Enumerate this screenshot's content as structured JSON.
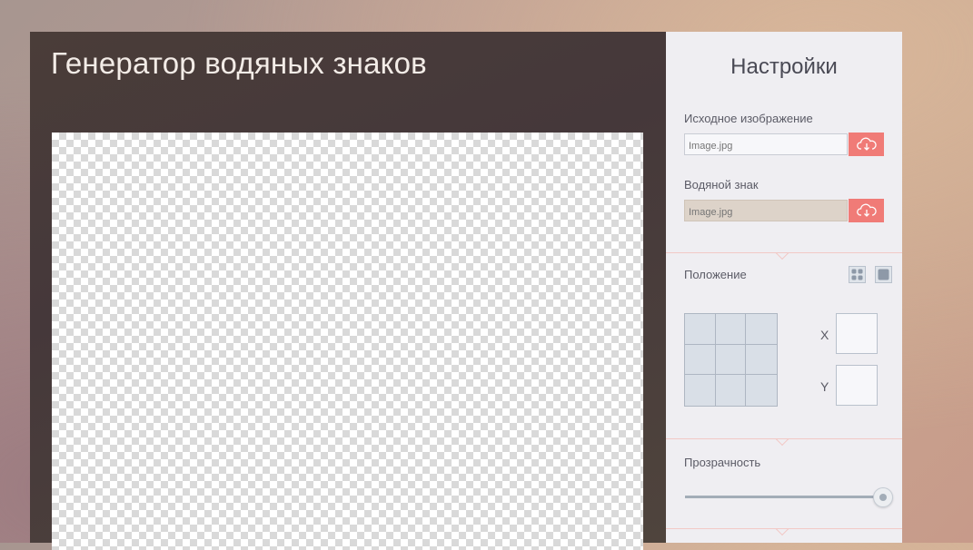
{
  "app": {
    "title": "Генератор водяных знаков"
  },
  "settings": {
    "title": "Настройки",
    "source_image": {
      "label": "Исходное изображение",
      "placeholder": "Image.jpg",
      "button_icon": "cloud-download-icon"
    },
    "watermark": {
      "label": "Водяной знак",
      "placeholder": "Image.jpg",
      "button_icon": "cloud-download-icon"
    },
    "position": {
      "label": "Положение",
      "modes": [
        "tile-mode",
        "single-mode"
      ],
      "x_label": "X",
      "y_label": "Y",
      "x_value": "",
      "y_value": ""
    },
    "opacity": {
      "label": "Прозрачность",
      "value": 1.0
    }
  },
  "colors": {
    "accent": "#f07b77",
    "panel_bg": "#efeef2",
    "main_bg": "#4a3d39"
  }
}
